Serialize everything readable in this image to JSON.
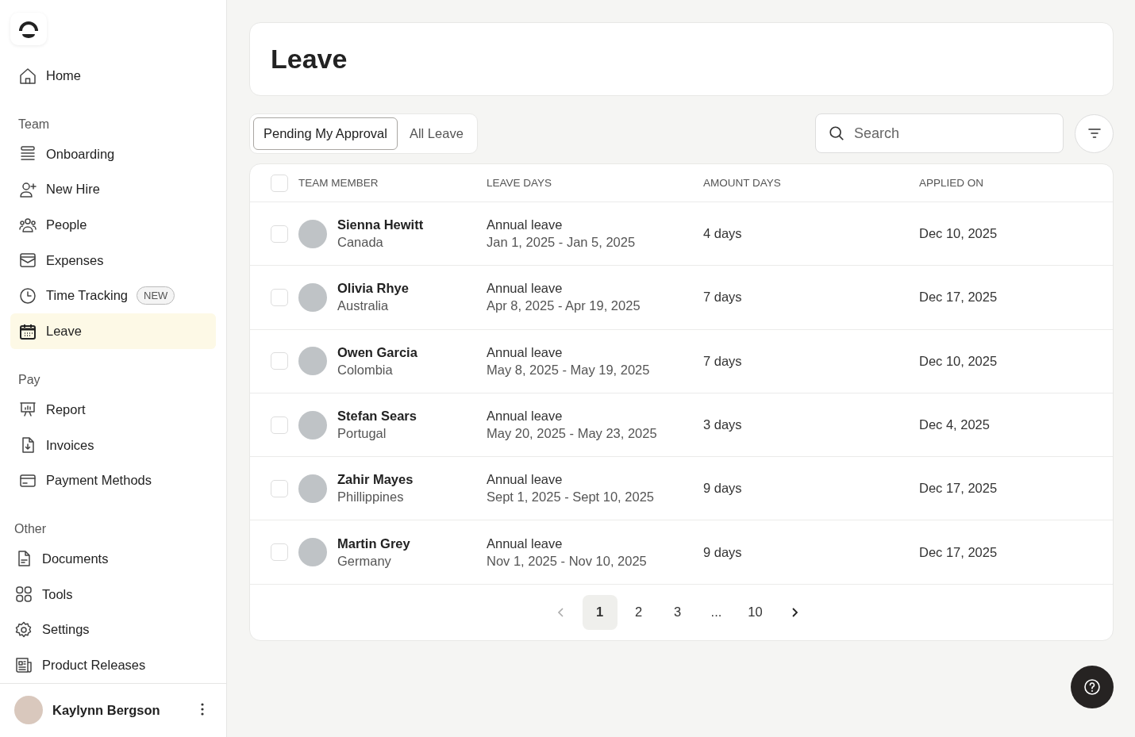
{
  "sidebar": {
    "sections": [
      {
        "items": [
          {
            "label": "Home",
            "selected": false
          }
        ]
      },
      {
        "heading": "Team",
        "items": [
          {
            "label": "Onboarding",
            "selected": false
          },
          {
            "label": "New Hire",
            "selected": false
          },
          {
            "label": "People",
            "selected": false
          },
          {
            "label": "Expenses",
            "selected": false
          },
          {
            "label": "Time Tracking",
            "badge": "NEW",
            "selected": false
          },
          {
            "label": "Leave",
            "selected": true
          }
        ]
      },
      {
        "heading": "Pay",
        "items": [
          {
            "label": "Report",
            "selected": false
          },
          {
            "label": "Invoices",
            "selected": false
          },
          {
            "label": "Payment Methods",
            "selected": false
          }
        ]
      },
      {
        "heading": "Other",
        "items": [
          {
            "label": "Documents",
            "selected": false
          },
          {
            "label": "Tools",
            "selected": false
          },
          {
            "label": "Settings",
            "selected": false
          },
          {
            "label": "Product Releases",
            "selected": false
          }
        ]
      }
    ],
    "user": {
      "name": "Kaylynn Bergson"
    }
  },
  "page": {
    "title": "Leave"
  },
  "tabs": [
    {
      "label": "Pending My Approval",
      "selected": true
    },
    {
      "label": "All Leave",
      "selected": false
    }
  ],
  "search": {
    "placeholder": "Search"
  },
  "table": {
    "select_all": {
      "checked": false
    },
    "columns": [
      "TEAM MEMBER",
      "LEAVE DAYS",
      "AMOUNT DAYS",
      "APPLIED ON"
    ],
    "rows": [
      {
        "checked": false,
        "name": "Sienna Hewitt",
        "country": "Canada",
        "leave_type": "Annual leave",
        "range": "Jan 1, 2025 - Jan 5, 2025",
        "amount": "4 days",
        "applied": "Dec 10, 2025"
      },
      {
        "checked": false,
        "name": "Olivia Rhye",
        "country": "Australia",
        "leave_type": "Annual leave",
        "range": "Apr 8, 2025 - Apr 19, 2025",
        "amount": "7 days",
        "applied": "Dec 17, 2025"
      },
      {
        "checked": false,
        "name": "Owen Garcia",
        "country": "Colombia",
        "leave_type": "Annual leave",
        "range": "May 8, 2025 - May 19, 2025",
        "amount": "7 days",
        "applied": "Dec 10, 2025"
      },
      {
        "checked": false,
        "name": "Stefan Sears",
        "country": "Portugal",
        "leave_type": "Annual leave",
        "range": "May 20, 2025 - May 23, 2025",
        "amount": "3 days",
        "applied": "Dec 4, 2025"
      },
      {
        "checked": false,
        "name": "Zahir Mayes",
        "country": "Phillippines",
        "leave_type": "Annual leave",
        "range": "Sept 1, 2025 - Sept 10, 2025",
        "amount": "9 days",
        "applied": "Dec 17, 2025"
      },
      {
        "checked": false,
        "name": "Martin Grey",
        "country": "Germany",
        "leave_type": "Annual leave",
        "range": "Nov 1, 2025 - Nov 10, 2025",
        "amount": "9 days",
        "applied": "Dec 17, 2025"
      }
    ]
  },
  "pagination": {
    "prev_disabled": true,
    "pages": [
      {
        "label": "1",
        "selected": true
      },
      {
        "label": "2",
        "selected": false
      },
      {
        "label": "3",
        "selected": false
      },
      {
        "label": "...",
        "selected": false
      },
      {
        "label": "10",
        "selected": false
      }
    ]
  }
}
